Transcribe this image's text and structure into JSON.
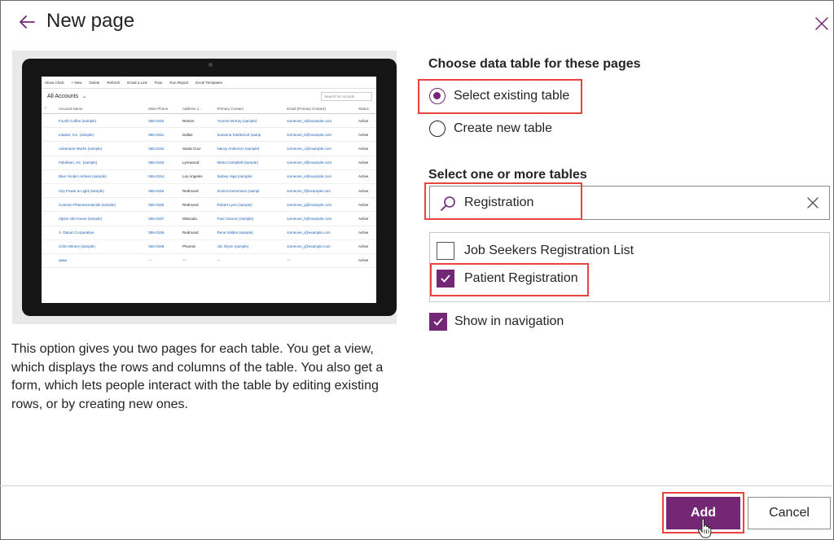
{
  "dialog": {
    "title": "New page"
  },
  "preview": {
    "toolbar": [
      "Show Chart",
      "+ New",
      "Delete",
      "Refresh",
      "Email a Link",
      "Flow",
      "Run Report",
      "Excel Templates"
    ],
    "view_title": "All Accounts",
    "search_placeholder": "Search for records",
    "columns": [
      "Account Name",
      "Main Phone",
      "Address 1...",
      "Primary Contact",
      "Email (Primary Contact)",
      "Status"
    ],
    "rows": [
      [
        "Fourth Coffee (sample)",
        "555-0150",
        "Renton",
        "Yvonne McKay (sample)",
        "someone_a@example.com",
        "Active"
      ],
      [
        "Litware, Inc. (sample)",
        "555-0151",
        "Dallas",
        "Susanna Stubberod (samp",
        "someone_b@example.com",
        "Active"
      ],
      [
        "Adventure Works (sample)",
        "555-0152",
        "Santa Cruz",
        "Nancy Anderson (sample)",
        "someone_c@example.com",
        "Active"
      ],
      [
        "Fabrikam, Inc. (sample)",
        "555-0153",
        "Lynnwood",
        "Maria Campbell (sample)",
        "someone_d@example.com",
        "Active"
      ],
      [
        "Blue Yonder Airlines (sample)",
        "555-0154",
        "Los Angeles",
        "Sidney Higa (sample)",
        "someone_e@example.com",
        "Active"
      ],
      [
        "City Power & Light (sample)",
        "555-0155",
        "Redmond",
        "Scott Konersmann (sampl",
        "someone_f@example.com",
        "Active"
      ],
      [
        "Contoso Pharmaceuticals (sample)",
        "555-0156",
        "Redmond",
        "Robert Lyon (sample)",
        "someone_g@example.com",
        "Active"
      ],
      [
        "Alpine Ski House (sample)",
        "555-0157",
        "Missoula",
        "Paul Cannon (sample)",
        "someone_h@example.com",
        "Active"
      ],
      [
        "A. Datum Corporation",
        "555-0158",
        "Redmond",
        "Rene Valdes (sample)",
        "someone_i@example.com",
        "Active"
      ],
      [
        "Coho Winery (sample)",
        "555-0159",
        "Phoenix",
        "Jim Glynn (sample)",
        "someone_j@example.com",
        "Active"
      ],
      [
        "aaaa",
        "---",
        "---",
        "---",
        "---",
        "Active"
      ]
    ]
  },
  "description": "This option gives you two pages for each table. You get a view, which displays the rows and columns of the table. You also get a form, which lets people interact with the table by editing existing rows, or by creating new ones.",
  "data_table": {
    "heading": "Choose data table for these pages",
    "options": [
      {
        "label": "Select existing table",
        "selected": true
      },
      {
        "label": "Create new table",
        "selected": false
      }
    ]
  },
  "tables": {
    "heading": "Select one or more tables",
    "search_value": "Registration",
    "results": [
      {
        "label": "Job Seekers Registration List",
        "checked": false
      },
      {
        "label": "Patient Registration",
        "checked": true
      }
    ]
  },
  "show_in_navigation": {
    "label": "Show in navigation",
    "checked": true
  },
  "buttons": {
    "add": "Add",
    "cancel": "Cancel"
  },
  "colors": {
    "accent": "#742774",
    "highlight": "#e8453c"
  }
}
